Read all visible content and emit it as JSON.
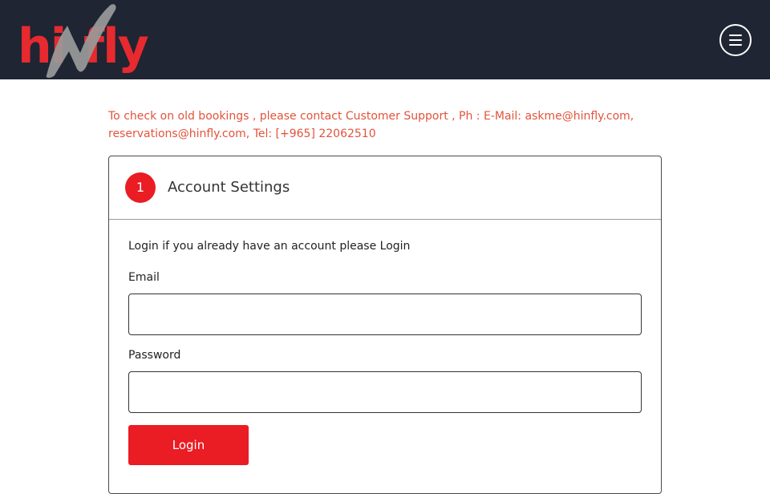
{
  "brand": {
    "logo_text": "hinfly",
    "header_bg": "#1f2533",
    "accent": "#ea1c24",
    "notice_color": "#e2533b"
  },
  "header": {
    "menu_icon": "hamburger-menu-icon"
  },
  "notice": {
    "text": "To check on old bookings , please contact Customer Support , Ph : E-Mail: askme@hinfly.com, reservations@hinfly.com, Tel: [+965] 22062510"
  },
  "account": {
    "step_number": "1",
    "title": "Account Settings",
    "intro": "Login if you already have an account please Login",
    "email_label": "Email",
    "email_value": "",
    "password_label": "Password",
    "password_value": "",
    "login_label": "Login"
  }
}
